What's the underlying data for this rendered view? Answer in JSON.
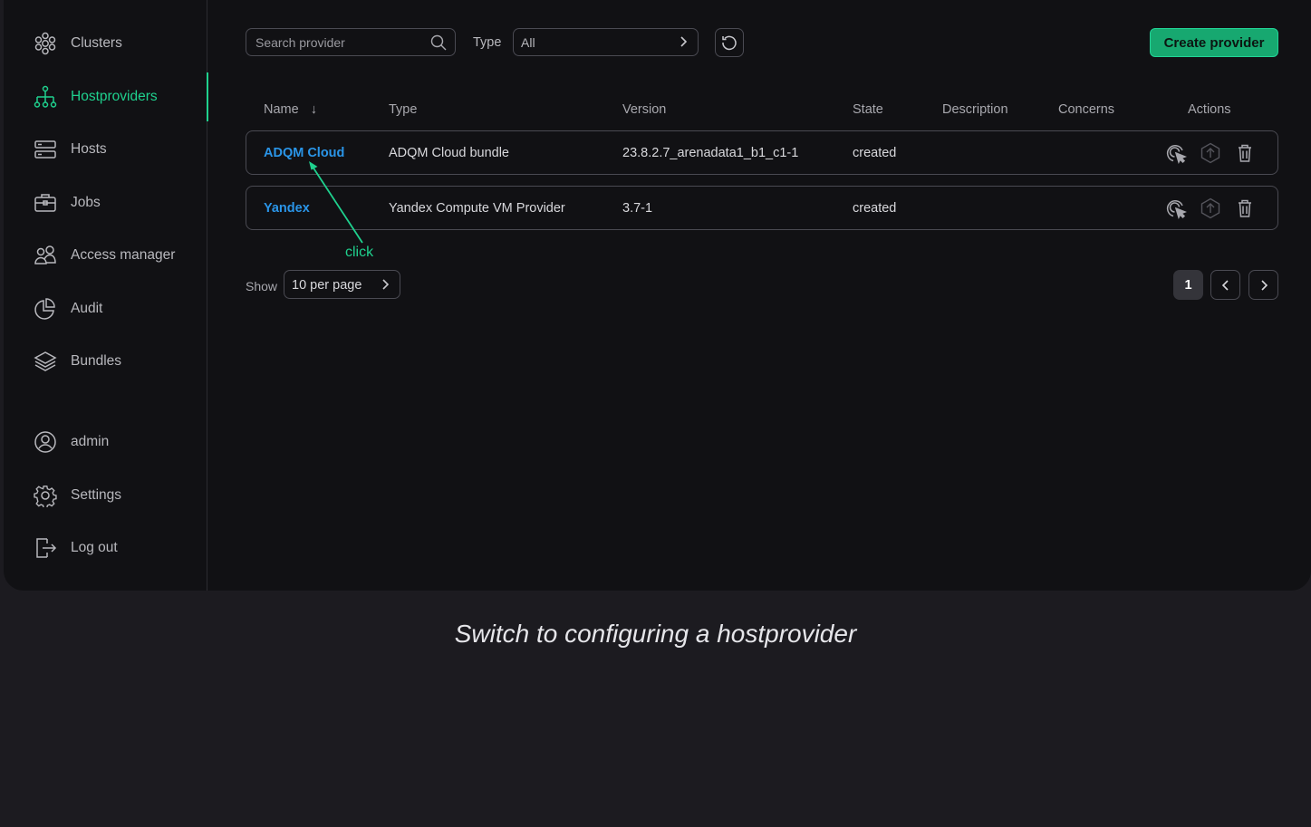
{
  "sidebar": {
    "items": [
      {
        "label": "Clusters",
        "icon": "clusters-icon",
        "active": false
      },
      {
        "label": "Hostproviders",
        "icon": "hierarchy-icon",
        "active": true
      },
      {
        "label": "Hosts",
        "icon": "server-icon",
        "active": false
      },
      {
        "label": "Jobs",
        "icon": "briefcase-icon",
        "active": false
      },
      {
        "label": "Access manager",
        "icon": "users-icon",
        "active": false
      },
      {
        "label": "Audit",
        "icon": "pie-chart-icon",
        "active": false
      },
      {
        "label": "Bundles",
        "icon": "layers-icon",
        "active": false
      }
    ],
    "bottom_items": [
      {
        "label": "admin",
        "icon": "user-circle-icon"
      },
      {
        "label": "Settings",
        "icon": "gear-icon"
      },
      {
        "label": "Log out",
        "icon": "logout-icon"
      }
    ]
  },
  "toolbar": {
    "search_placeholder": "Search provider",
    "type_label": "Type",
    "type_value": "All",
    "create_label": "Create provider"
  },
  "table": {
    "columns": [
      "Name",
      "Type",
      "Version",
      "State",
      "Description",
      "Concerns",
      "Actions"
    ],
    "sort_indicator": "↓",
    "rows": [
      {
        "name": "ADQM Cloud",
        "type": "ADQM Cloud bundle",
        "version": "23.8.2.7_arenadata1_b1_c1-1",
        "state": "created",
        "description": "",
        "concerns": ""
      },
      {
        "name": "Yandex",
        "type": "Yandex Compute VM Provider",
        "version": "3.7-1",
        "state": "created",
        "description": "",
        "concerns": ""
      }
    ]
  },
  "pagination": {
    "show_label": "Show",
    "per_page": "10 per page",
    "current_page": "1"
  },
  "annotation": {
    "label": "click"
  },
  "caption": "Switch to configuring a hostprovider",
  "colors": {
    "accent": "#1fd18e",
    "link": "#2a95e8",
    "button": "#17a870"
  }
}
